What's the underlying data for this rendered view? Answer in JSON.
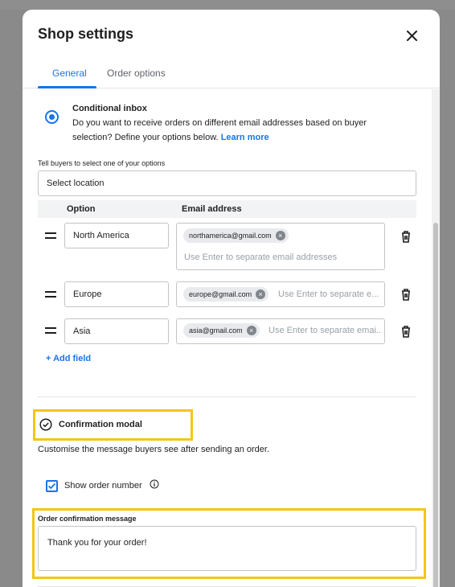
{
  "dialog": {
    "title": "Shop settings",
    "tabs": [
      {
        "label": "General",
        "active": true
      },
      {
        "label": "Order options",
        "active": false
      }
    ]
  },
  "conditional_inbox": {
    "title": "Conditional inbox",
    "description": "Do you want to receive orders on different email addresses based on buyer selection? Define your options below.",
    "learn_more": "Learn more",
    "selected": true
  },
  "selection": {
    "label": "Tell buyers to select one of your options",
    "value": "Select location"
  },
  "table": {
    "headers": {
      "option": "Option",
      "email": "Email address"
    },
    "rows": [
      {
        "option": "North America",
        "email": "northamerica@gmail.com",
        "placeholder": "Use Enter to separate email addresses"
      },
      {
        "option": "Europe",
        "email": "europe@gmail.com",
        "placeholder": "Use Enter to separate e..."
      },
      {
        "option": "Asia",
        "email": "asia@gmail.com",
        "placeholder": "Use Enter to separate emai..."
      }
    ],
    "add_field": "+ Add field"
  },
  "confirmation": {
    "title": "Confirmation modal",
    "description": "Customise the message buyers see after sending an order.",
    "show_order_number": {
      "label": "Show order number",
      "checked": true
    },
    "message_label": "Order confirmation message",
    "message_value": "Thank you for your order!"
  },
  "colors": {
    "accent": "#1a73e8",
    "highlight": "#f5c518"
  }
}
